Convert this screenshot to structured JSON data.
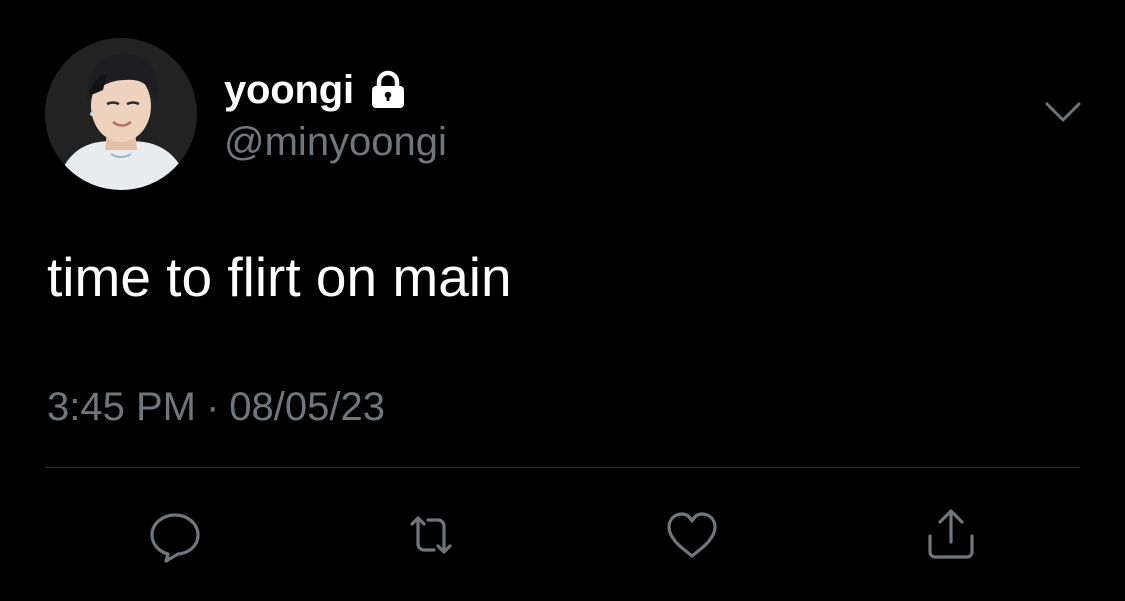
{
  "tweet": {
    "display_name": "yoongi",
    "handle": "@minyoongi",
    "text": "time to flirt on main",
    "time": "3:45 PM",
    "separator": "·",
    "date": "08/05/23",
    "protected": true
  },
  "icons": {
    "lock": "lock-icon",
    "menu": "chevron-down-icon",
    "reply": "reply-icon",
    "retweet": "retweet-icon",
    "like": "heart-icon",
    "share": "share-icon"
  },
  "colors": {
    "background": "#000000",
    "primary_text": "#ffffff",
    "secondary_text": "#71767b",
    "divider": "#2f3336"
  }
}
